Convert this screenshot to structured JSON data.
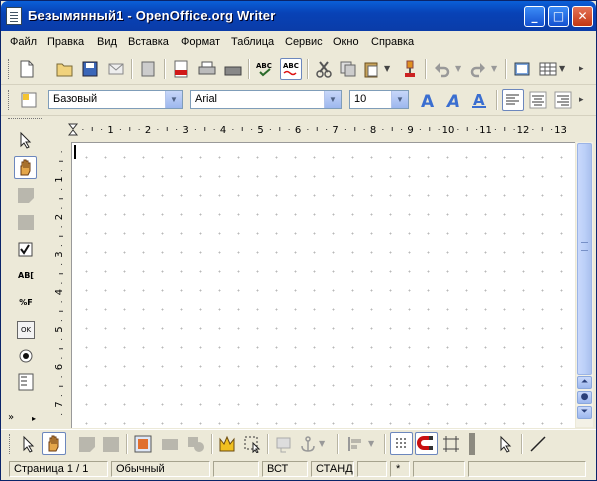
{
  "window": {
    "title": "Безымянный1 - OpenOffice.org Writer",
    "minimize_label": "_",
    "maximize_label": "□",
    "close_label": "✕"
  },
  "menu": [
    "Файл",
    "Правка",
    "Вид",
    "Вставка",
    "Формат",
    "Таблица",
    "Сервис",
    "Окно",
    "Справка"
  ],
  "format_toolbar": {
    "style_value": "Базовый",
    "font_value": "Arial",
    "size_value": "10"
  },
  "ruler": {
    "h_labels": [
      "1",
      "2",
      "3",
      "4",
      "5",
      "6",
      "7",
      "8",
      "9",
      "10",
      "11",
      "12",
      "13"
    ],
    "v_labels": [
      "1",
      "2",
      "3",
      "4",
      "5",
      "6",
      "7"
    ]
  },
  "sidebar": {
    "textbox_label": "AB[",
    "formatted_label": "%F",
    "ok_label": "OK"
  },
  "statusbar": {
    "page": "Страница  1 / 1",
    "style": "Обычный",
    "mode1": "ВСТ",
    "mode2": "СТАНД",
    "modified": "*"
  },
  "colors": {
    "title_bar": "#0a48c2",
    "accent": "#316ac5"
  }
}
